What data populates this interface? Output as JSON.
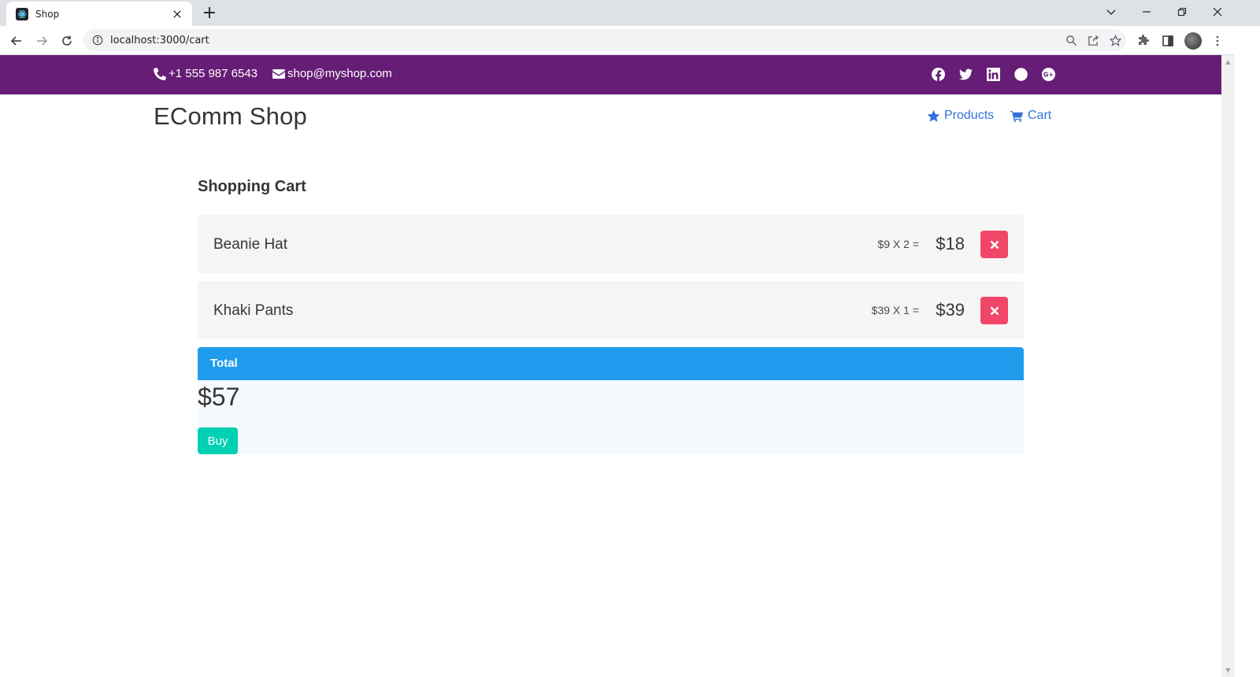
{
  "browser": {
    "tab_title": "Shop",
    "url": "localhost:3000/cart",
    "new_tab_label": "+"
  },
  "topbar": {
    "phone": "+1 555 987 6543",
    "email": "shop@myshop.com",
    "socials": [
      "facebook-icon",
      "twitter-icon",
      "linkedin-icon",
      "dribbble-icon",
      "google-plus-icon"
    ],
    "background_color": "#661d75"
  },
  "header": {
    "brand": "EComm Shop",
    "nav": [
      {
        "label": "Products",
        "icon": "star-icon"
      },
      {
        "label": "Cart",
        "icon": "shopping-cart-icon"
      }
    ],
    "link_color": "#3273dc"
  },
  "cart": {
    "title": "Shopping Cart",
    "items": [
      {
        "name": "Beanie Hat",
        "qty_text": "$9 X 2 =",
        "subtotal": "$18"
      },
      {
        "name": "Khaki Pants",
        "qty_text": "$39 X 1 =",
        "subtotal": "$39"
      }
    ],
    "total_label": "Total",
    "total_amount": "$57",
    "buy_label": "Buy",
    "colors": {
      "remove": "#f14668",
      "total_header": "#209cee",
      "buy": "#00d1b2"
    }
  }
}
